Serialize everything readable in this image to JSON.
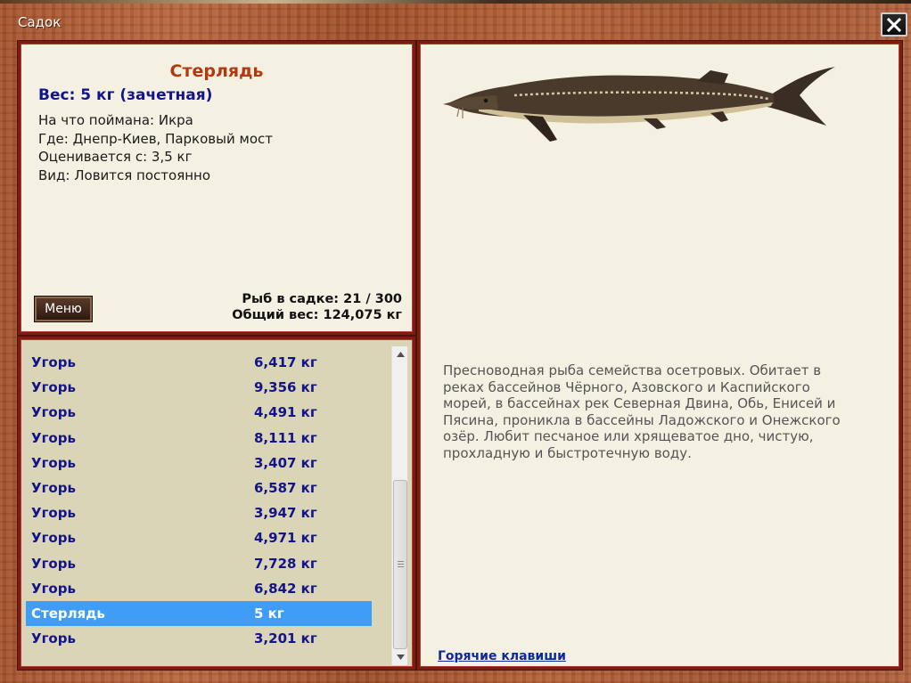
{
  "window": {
    "title": "Садок",
    "close_label": "✕"
  },
  "fish_info": {
    "name": "Стерлядь",
    "weight_line": "Вес: 5 кг (зачетная)",
    "bait": "На что поймана: Икра",
    "location": "Где: Днепр-Киев, Парковый мост",
    "threshold": "Оценивается с: 3,5 кг",
    "kind": "Вид: Ловится постоянно"
  },
  "menu": {
    "label": "Меню"
  },
  "stats": {
    "fish_in_cage": "Рыб в садке: 21 / 300",
    "total_weight": "Общий вес: 124,075 кг"
  },
  "list": {
    "rows": [
      {
        "name": "Угорь",
        "weight": "6,417 кг"
      },
      {
        "name": "Угорь",
        "weight": "9,356 кг"
      },
      {
        "name": "Угорь",
        "weight": "4,491 кг"
      },
      {
        "name": "Угорь",
        "weight": "8,111 кг"
      },
      {
        "name": "Угорь",
        "weight": "3,407 кг"
      },
      {
        "name": "Угорь",
        "weight": "6,587 кг"
      },
      {
        "name": "Угорь",
        "weight": "3,947 кг"
      },
      {
        "name": "Угорь",
        "weight": "4,971 кг"
      },
      {
        "name": "Угорь",
        "weight": "7,728 кг"
      },
      {
        "name": "Угорь",
        "weight": "6,842 кг"
      },
      {
        "name": "Стерлядь",
        "weight": "5 кг",
        "selected": true
      },
      {
        "name": "Угорь",
        "weight": "3,201 кг"
      }
    ],
    "selected_color": "#3f9cf7"
  },
  "description": {
    "text": "Пресноводная рыба семейства осетровых. Обитает в реках бассейнов Чёрного, Азовского и Каспийского морей, в бассейнах рек Северная Двина, Обь, Енисей и Пясина, проникла в бассейны Ладожского и Онежского озёр. Любит песчаное или хрящеватое дно, чистую, прохладную и быстротечную воду."
  },
  "hotkeys": {
    "label": "Горячие клавиши"
  },
  "colors": {
    "frame": "#7a1e14",
    "panel_bg": "#f4f1e2",
    "list_bg": "#d9d5b6",
    "fish_name": "#b5380f",
    "list_text": "#14148a"
  },
  "icons": {
    "close": "close-icon",
    "scroll_up": "arrow-up-icon",
    "scroll_down": "arrow-down-icon",
    "fish_picture": "sterlet-fish-image"
  }
}
